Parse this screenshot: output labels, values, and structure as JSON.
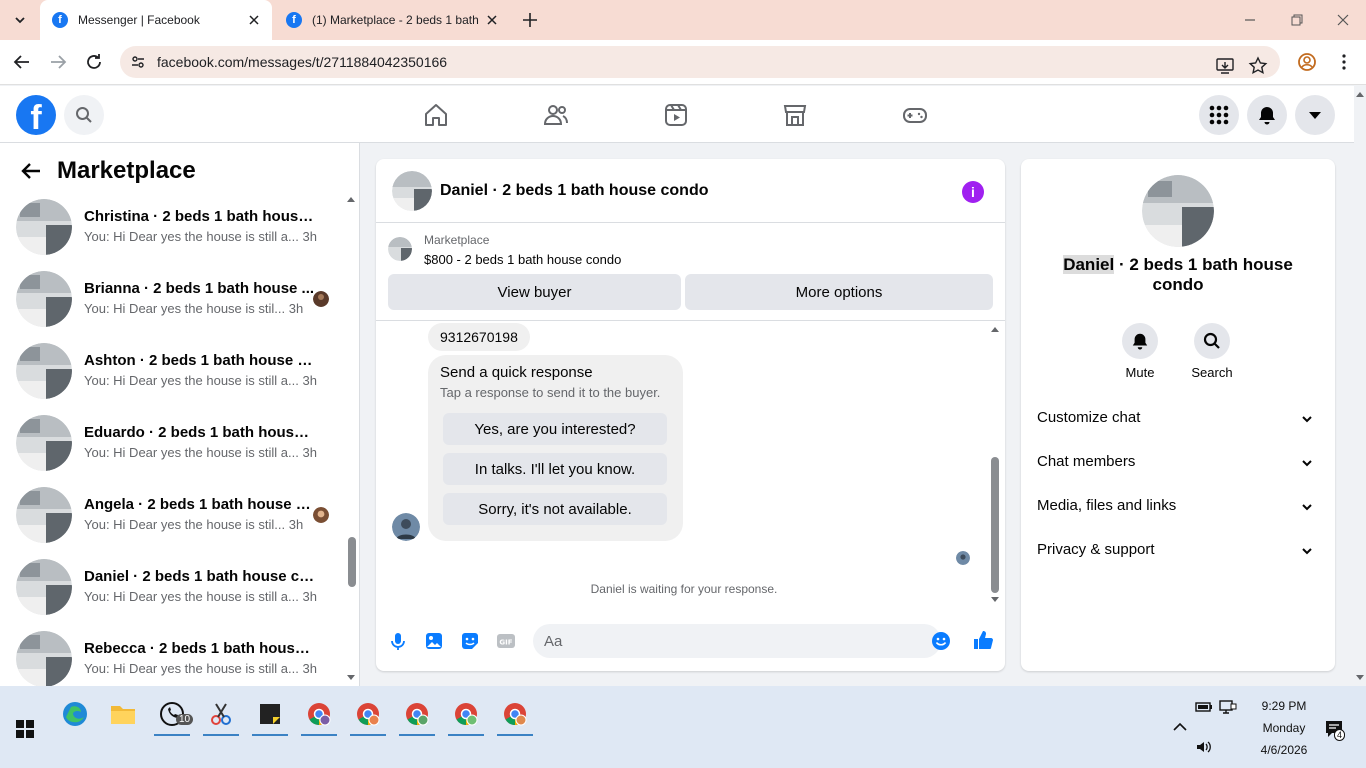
{
  "browser": {
    "tabs": [
      {
        "title": "Messenger | Facebook",
        "active": true
      },
      {
        "title": "(1) Marketplace - 2 beds 1 bath",
        "active": false
      }
    ],
    "url": "facebook.com/messages/t/2711884042350166"
  },
  "sidebar": {
    "title": "Marketplace",
    "conversations": [
      {
        "name": "Christina · 2 beds 1 bath house c...",
        "preview": "You: Hi Dear yes the house is still a...",
        "time": "3h"
      },
      {
        "name": "Brianna · 2 beds 1 bath house ...",
        "preview": "You: Hi Dear yes the house is stil...",
        "time": "3h"
      },
      {
        "name": "Ashton · 2 beds 1 bath house co...",
        "preview": "You: Hi Dear yes the house is still a...",
        "time": "3h"
      },
      {
        "name": "Eduardo · 2 beds 1 bath house c...",
        "preview": "You: Hi Dear yes the house is still a...",
        "time": "3h"
      },
      {
        "name": "Angela · 2 beds 1 bath house c...",
        "preview": "You: Hi Dear yes the house is stil...",
        "time": "3h"
      },
      {
        "name": "Daniel · 2 beds 1 bath house con...",
        "preview": "You: Hi Dear yes the house is still a...",
        "time": "3h"
      },
      {
        "name": "Rebecca · 2 beds 1 bath house c...",
        "preview": "You: Hi Dear yes the house is still a...",
        "time": "3h"
      }
    ]
  },
  "chat": {
    "title": "Daniel · 2 beds 1 bath house condo",
    "marketplace_label": "Marketplace",
    "listing": "$800 - 2 beds 1 bath house condo",
    "view_buyer": "View buyer",
    "more_options": "More options",
    "phone_message": "9312670198",
    "quick_response": {
      "heading": "Send a quick response",
      "subtitle": "Tap a response to send it to the buyer.",
      "options": [
        "Yes, are you interested?",
        "In talks. I'll let you know.",
        "Sorry, it's not available."
      ]
    },
    "waiting_text": "Daniel is waiting for your response.",
    "input_placeholder": "Aa"
  },
  "info_panel": {
    "name_first": "Daniel",
    "name_rest": " · 2 beds 1 bath house condo",
    "actions": [
      {
        "label": "Mute",
        "icon": "bell-icon"
      },
      {
        "label": "Search",
        "icon": "search-icon"
      }
    ],
    "sections": [
      "Customize chat",
      "Chat members",
      "Media, files and links",
      "Privacy & support"
    ]
  },
  "taskbar": {
    "whatsapp_badge": "10",
    "time": "9:29 PM",
    "day": "Monday",
    "date": "4/6/2026",
    "notification_count": "4"
  },
  "colors": {
    "facebook_blue": "#1877f2",
    "messenger_blue": "#0a7cff",
    "info_purple": "#a020f0",
    "tab_strip": "#f7dcd3"
  }
}
